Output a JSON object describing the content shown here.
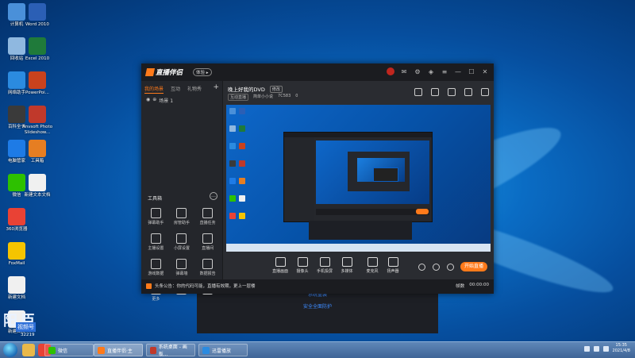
{
  "desktop": {
    "icons_col1": [
      {
        "label": "计算机",
        "icon": "computer-icon",
        "color": "#4a90d9"
      },
      {
        "label": "回收站",
        "icon": "recycle-bin-icon",
        "color": "#8fb8e0"
      },
      {
        "label": "网络助手",
        "icon": "network-icon",
        "color": "#2b8be0"
      },
      {
        "label": "百科全书",
        "icon": "app-icon",
        "color": "#3a3a3a"
      },
      {
        "label": "电脑管家",
        "icon": "shield-icon",
        "color": "#1e7be6"
      },
      {
        "label": "微信",
        "icon": "wechat-icon",
        "color": "#2dc100"
      },
      {
        "label": "360浏览器",
        "icon": "chrome-icon",
        "color": "#e94235"
      },
      {
        "label": "FoxMail",
        "icon": "folder-icon",
        "color": "#f5c400"
      },
      {
        "label": "新建文档",
        "icon": "document-icon",
        "color": "#f0f0f0"
      },
      {
        "label": "新建文件",
        "icon": "document-icon",
        "color": "#f0f0f0"
      }
    ],
    "icons_col2": [
      {
        "label": "Word 2010",
        "icon": "word-icon",
        "color": "#2b5fb5"
      },
      {
        "label": "Excel 2010",
        "icon": "excel-icon",
        "color": "#1f7a3a"
      },
      {
        "label": "PowerPoi...",
        "icon": "powerpoint-icon",
        "color": "#c9421d"
      },
      {
        "label": "Anvsoft Photo Slideshow...",
        "icon": "slideshow-icon",
        "color": "#c0392b"
      },
      {
        "label": "工具箱",
        "icon": "tools-icon",
        "color": "#e67e22"
      },
      {
        "label": "新建文本文档",
        "icon": "document-icon",
        "color": "#f0f0f0"
      }
    ],
    "watermark": {
      "big": "阳 臣",
      "small": "视频号",
      "version": "32219"
    }
  },
  "background_window": {
    "line1": "系统重装",
    "line2": "安全全面防护"
  },
  "app": {
    "name": "直播伴侣",
    "badge": "体验 ▸",
    "left_tabs": [
      "我的场景",
      "互动",
      "礼物秀"
    ],
    "scene_label": "场景 1",
    "tools_title": "工具箱",
    "tools": [
      {
        "label": "弹幕助手",
        "icon": "danmu-icon"
      },
      {
        "label": "房管助手",
        "icon": "user-icon"
      },
      {
        "label": "直播任务",
        "icon": "task-icon"
      },
      {
        "label": "主播设置",
        "icon": "settings-icon"
      },
      {
        "label": "小屏设置",
        "icon": "download-icon"
      },
      {
        "label": "直播间",
        "icon": "room-icon"
      },
      {
        "label": "游戏数据",
        "icon": "game-icon"
      },
      {
        "label": "弹幕墙",
        "icon": "wall-icon"
      },
      {
        "label": "数据报告",
        "icon": "report-icon"
      },
      {
        "label": "更多",
        "icon": "more-icon"
      },
      {
        "label": "",
        "icon": "music-icon"
      },
      {
        "label": "",
        "icon": "gift-icon"
      }
    ],
    "stream_title": "晚上好我的DVD",
    "edit_label": "修改",
    "category": "互动直播",
    "meta_user": "简单小小说",
    "meta_id": "7C583",
    "meta_likes": "0",
    "bottom_buttons": [
      {
        "label": "直播画面",
        "icon": "screen-icon"
      },
      {
        "label": "摄像头",
        "icon": "camera-icon"
      },
      {
        "label": "手机投屏",
        "icon": "phone-icon"
      },
      {
        "label": "多媒体",
        "icon": "media-icon"
      },
      {
        "label": "麦克风",
        "icon": "microphone-icon"
      },
      {
        "label": "扬声器",
        "icon": "speaker-icon"
      }
    ],
    "go_live_label": "开始直播",
    "notice": "头条公告：你的代码可能，直播有效期，更上一层楼",
    "status_right": [
      "帧数",
      "00:00:00"
    ]
  },
  "taskbar": {
    "tasks": [
      {
        "label": "微信",
        "active": false,
        "color": "#2dc100"
      },
      {
        "label": "直播伴侣·主",
        "active": true,
        "color": "#ff7a1a"
      },
      {
        "label": "系统桌面 - 画板...",
        "active": false,
        "color": "#c0392b"
      },
      {
        "label": "迅雷播放",
        "active": false,
        "color": "#2b8be0"
      }
    ],
    "time": "15:35",
    "date": "2021/4/8"
  }
}
